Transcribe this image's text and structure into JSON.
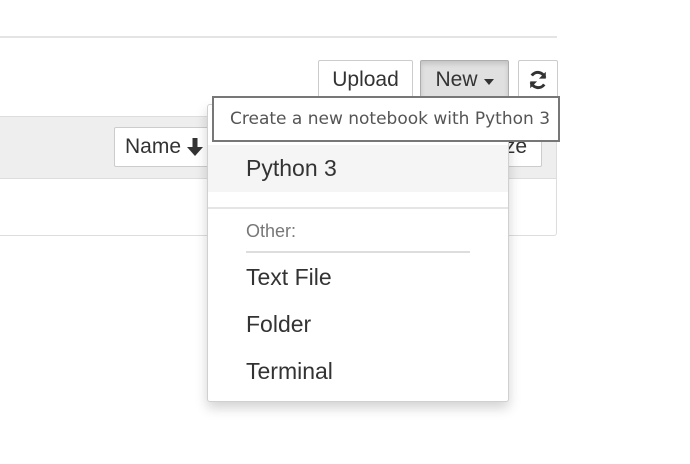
{
  "toolbar": {
    "upload_label": "Upload",
    "new_label": "New",
    "refresh_icon": "refresh-icon"
  },
  "list": {
    "sort_name_label": "Name",
    "sort_name_icon": "arrow-down-icon",
    "sort_size_label_visible": "ze"
  },
  "new_menu": {
    "tooltip": "Create a new notebook with Python 3",
    "kernels": [
      "Python 3"
    ],
    "other_header": "Other:",
    "other_items": [
      "Text File",
      "Folder",
      "Terminal"
    ]
  },
  "colors": {
    "active_button_bg": "#e0e0e0",
    "header_bg": "#eeeeee",
    "hover_item_bg": "#f5f5f5",
    "text": "#333333",
    "muted_text": "#777777"
  }
}
